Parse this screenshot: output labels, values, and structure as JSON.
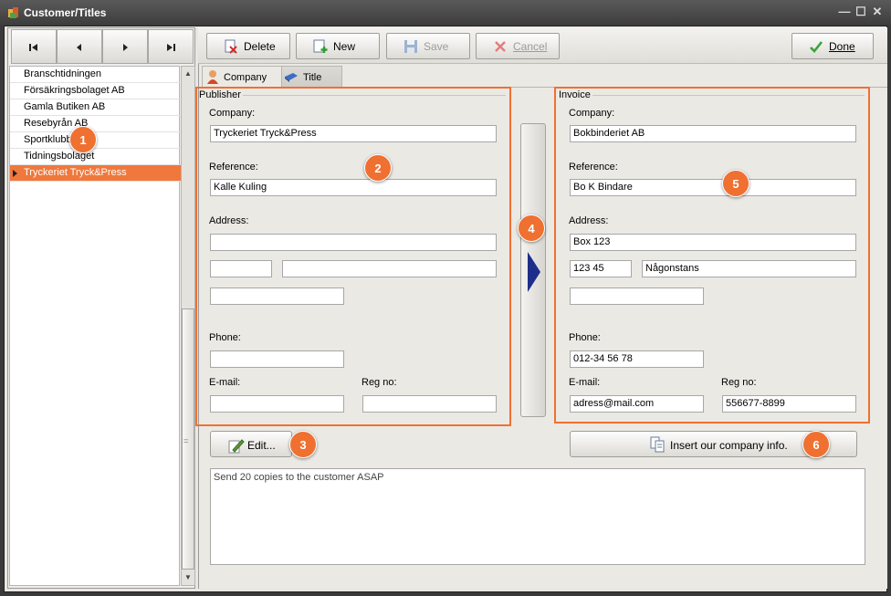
{
  "window": {
    "title": "Customer/Titles"
  },
  "nav": {
    "first": "first-record",
    "prev": "previous-record",
    "next": "next-record",
    "last": "last-record"
  },
  "list": {
    "items": [
      "Branschtidningen",
      "Försäkringsbolaget AB",
      "Gamla Butiken AB",
      "Resebyrån AB",
      "Sportklubben",
      "Tidningsbolaget",
      "Tryckeriet Tryck&Press"
    ],
    "selected_index": 6
  },
  "toolbar": {
    "delete": "Delete",
    "new": "New",
    "save": "Save",
    "cancel": "Cancel",
    "done": "Done"
  },
  "tabs": {
    "company": "Company",
    "title": "Title"
  },
  "publisher": {
    "group_label": "Publisher",
    "company_label": "Company:",
    "company": "Tryckeriet Tryck&Press",
    "reference_label": "Reference:",
    "reference": "Kalle Kuling",
    "address_label": "Address:",
    "address1": "",
    "zip": "",
    "city": "",
    "country": "",
    "phone_label": "Phone:",
    "phone": "",
    "email_label": "E-mail:",
    "email": "",
    "regno_label": "Reg no:",
    "regno": ""
  },
  "invoice": {
    "group_label": "Invoice",
    "company_label": "Company:",
    "company": "Bokbinderiet AB",
    "reference_label": "Reference:",
    "reference": "Bo K Bindare",
    "address_label": "Address:",
    "address1": "Box 123",
    "zip": "123 45",
    "city": "Någonstans",
    "country": "",
    "phone_label": "Phone:",
    "phone": "012-34 56 78",
    "email_label": "E-mail:",
    "email": "adress@mail.com",
    "regno_label": "Reg no:",
    "regno": "556677-8899"
  },
  "actions": {
    "edit": "Edit...",
    "insert_company_info": "Insert our company info."
  },
  "notes": {
    "text": "Send 20 copies to the customer ASAP"
  },
  "badges": [
    "1",
    "2",
    "3",
    "4",
    "5",
    "6"
  ],
  "colors": {
    "accent": "#f07033",
    "selection": "#f0783c"
  }
}
